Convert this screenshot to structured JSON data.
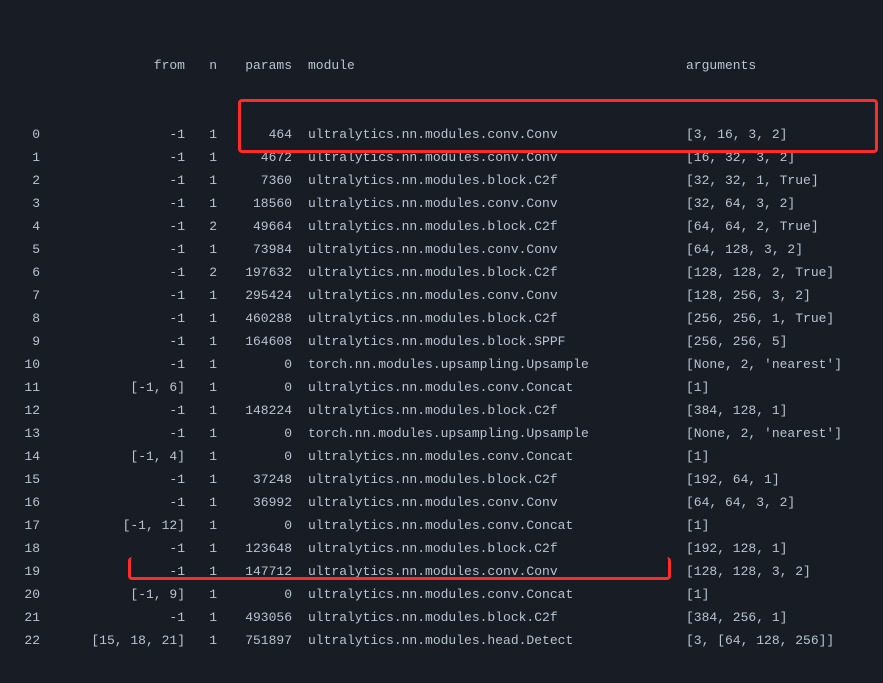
{
  "headers": {
    "idx": "",
    "from": "from",
    "n": "n",
    "params": "params",
    "module": "module",
    "args": "arguments"
  },
  "rows": [
    {
      "idx": "0",
      "from": "-1",
      "n": "1",
      "params": "464",
      "module": "ultralytics.nn.modules.conv.Conv",
      "args": "[3, 16, 3, 2]"
    },
    {
      "idx": "1",
      "from": "-1",
      "n": "1",
      "params": "4672",
      "module": "ultralytics.nn.modules.conv.Conv",
      "args": "[16, 32, 3, 2]"
    },
    {
      "idx": "2",
      "from": "-1",
      "n": "1",
      "params": "7360",
      "module": "ultralytics.nn.modules.block.C2f",
      "args": "[32, 32, 1, True]"
    },
    {
      "idx": "3",
      "from": "-1",
      "n": "1",
      "params": "18560",
      "module": "ultralytics.nn.modules.conv.Conv",
      "args": "[32, 64, 3, 2]"
    },
    {
      "idx": "4",
      "from": "-1",
      "n": "2",
      "params": "49664",
      "module": "ultralytics.nn.modules.block.C2f",
      "args": "[64, 64, 2, True]"
    },
    {
      "idx": "5",
      "from": "-1",
      "n": "1",
      "params": "73984",
      "module": "ultralytics.nn.modules.conv.Conv",
      "args": "[64, 128, 3, 2]"
    },
    {
      "idx": "6",
      "from": "-1",
      "n": "2",
      "params": "197632",
      "module": "ultralytics.nn.modules.block.C2f",
      "args": "[128, 128, 2, True]"
    },
    {
      "idx": "7",
      "from": "-1",
      "n": "1",
      "params": "295424",
      "module": "ultralytics.nn.modules.conv.Conv",
      "args": "[128, 256, 3, 2]"
    },
    {
      "idx": "8",
      "from": "-1",
      "n": "1",
      "params": "460288",
      "module": "ultralytics.nn.modules.block.C2f",
      "args": "[256, 256, 1, True]"
    },
    {
      "idx": "9",
      "from": "-1",
      "n": "1",
      "params": "164608",
      "module": "ultralytics.nn.modules.block.SPPF",
      "args": "[256, 256, 5]"
    },
    {
      "idx": "10",
      "from": "-1",
      "n": "1",
      "params": "0",
      "module": "torch.nn.modules.upsampling.Upsample",
      "args": "[None, 2, 'nearest']"
    },
    {
      "idx": "11",
      "from": "[-1, 6]",
      "n": "1",
      "params": "0",
      "module": "ultralytics.nn.modules.conv.Concat",
      "args": "[1]"
    },
    {
      "idx": "12",
      "from": "-1",
      "n": "1",
      "params": "148224",
      "module": "ultralytics.nn.modules.block.C2f",
      "args": "[384, 128, 1]"
    },
    {
      "idx": "13",
      "from": "-1",
      "n": "1",
      "params": "0",
      "module": "torch.nn.modules.upsampling.Upsample",
      "args": "[None, 2, 'nearest']"
    },
    {
      "idx": "14",
      "from": "[-1, 4]",
      "n": "1",
      "params": "0",
      "module": "ultralytics.nn.modules.conv.Concat",
      "args": "[1]"
    },
    {
      "idx": "15",
      "from": "-1",
      "n": "1",
      "params": "37248",
      "module": "ultralytics.nn.modules.block.C2f",
      "args": "[192, 64, 1]"
    },
    {
      "idx": "16",
      "from": "-1",
      "n": "1",
      "params": "36992",
      "module": "ultralytics.nn.modules.conv.Conv",
      "args": "[64, 64, 3, 2]"
    },
    {
      "idx": "17",
      "from": "[-1, 12]",
      "n": "1",
      "params": "0",
      "module": "ultralytics.nn.modules.conv.Concat",
      "args": "[1]"
    },
    {
      "idx": "18",
      "from": "-1",
      "n": "1",
      "params": "123648",
      "module": "ultralytics.nn.modules.block.C2f",
      "args": "[192, 128, 1]"
    },
    {
      "idx": "19",
      "from": "-1",
      "n": "1",
      "params": "147712",
      "module": "ultralytics.nn.modules.conv.Conv",
      "args": "[128, 128, 3, 2]"
    },
    {
      "idx": "20",
      "from": "[-1, 9]",
      "n": "1",
      "params": "0",
      "module": "ultralytics.nn.modules.conv.Concat",
      "args": "[1]"
    },
    {
      "idx": "21",
      "from": "-1",
      "n": "1",
      "params": "493056",
      "module": "ultralytics.nn.modules.block.C2f",
      "args": "[384, 256, 1]"
    },
    {
      "idx": "22",
      "from": "[15, 18, 21]",
      "n": "1",
      "params": "751897",
      "module": "ultralytics.nn.modules.head.Detect",
      "args": "[3, [64, 128, 256]]"
    }
  ],
  "highlight_box_1": "rows-3-4-highlight",
  "highlight_box_2": "bottom-highlight"
}
